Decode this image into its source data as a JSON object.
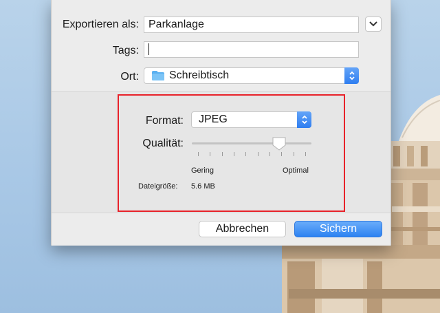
{
  "dialog": {
    "export_as": {
      "label": "Exportieren als:",
      "value": "Parkanlage"
    },
    "tags": {
      "label": "Tags:",
      "value": ""
    },
    "location": {
      "label": "Ort:",
      "value": "Schreibtisch"
    },
    "format": {
      "label": "Format:",
      "value": "JPEG"
    },
    "quality": {
      "label": "Qualität:",
      "min_label": "Gering",
      "max_label": "Optimal",
      "level": 0.73
    },
    "filesize": {
      "label": "Dateigröße:",
      "value": "5.6 MB"
    },
    "buttons": {
      "cancel": "Abbrechen",
      "save": "Sichern"
    }
  },
  "colors": {
    "accent": "#2f7ef0",
    "highlight_border": "#e8222a",
    "folder": "#5ab0f0"
  },
  "icons": [
    "chevron-down-icon",
    "folder-icon",
    "updown-chevron-icon",
    "slider-thumb-icon"
  ]
}
